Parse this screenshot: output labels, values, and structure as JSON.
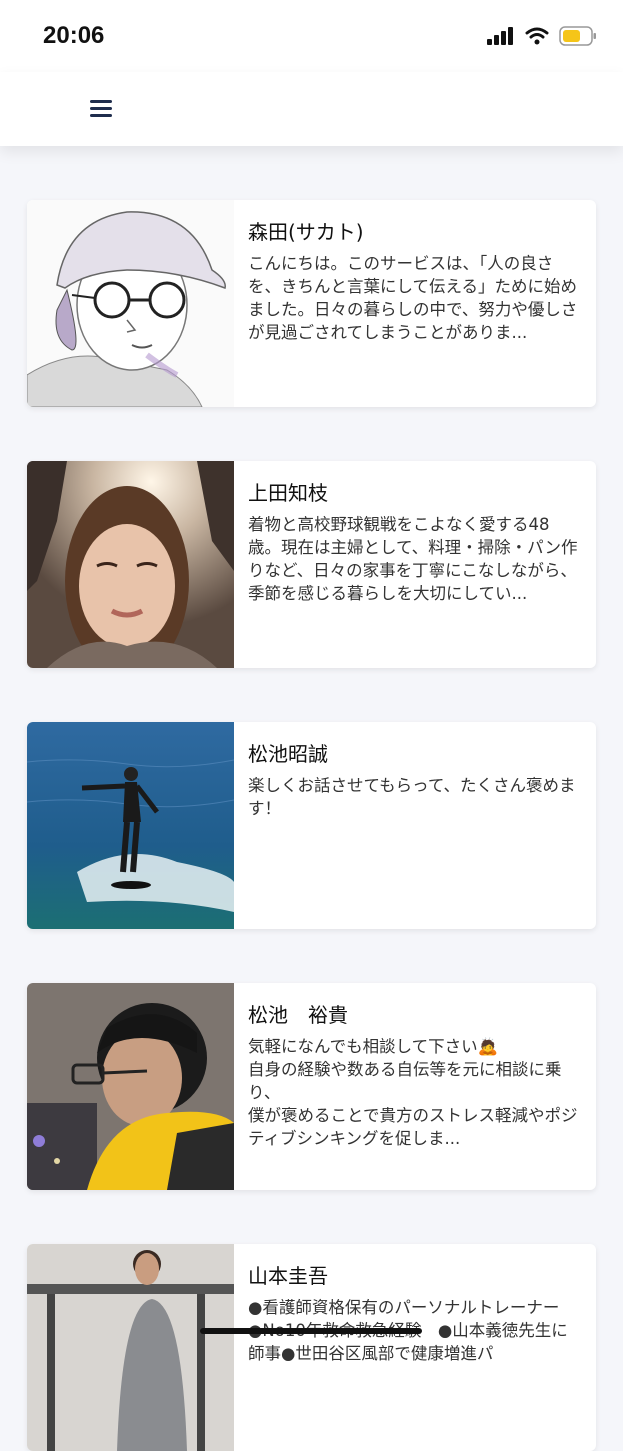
{
  "status_bar": {
    "time": "20:06",
    "icons": [
      "signal-icon",
      "wifi-icon",
      "battery-icon"
    ],
    "battery_color": "#f5c518"
  },
  "header": {
    "menu_icon": "hamburger-menu-icon",
    "accent": "#1f2d4d"
  },
  "profiles": [
    {
      "name": "森田(サカト)",
      "description": "こんにちは。このサービスは、「人の良さを、きちんと言葉にして伝える」ために始めました。日々の暮らしの中で、努力や優しさが見過ごされてしまうことがありま...",
      "photo": "sketch-portrait-with-cap"
    },
    {
      "name": "上田知枝",
      "description": "着物と高校野球観戦をこよなく愛する48歳。現在は主婦として、料理・掃除・パン作りなど、日々の家事を丁寧にこなしながら、季節を感じる暮らしを大切にしてい...",
      "photo": "woman-portrait"
    },
    {
      "name": "松池昭誠",
      "description": "楽しくお話させてもらって、たくさん褒めます！",
      "photo": "surfer-on-wave"
    },
    {
      "name": "松池　裕貴",
      "description": "気軽になんでも相談して下さい🙇\n自身の経験や数ある自伝等を元に相談に乗り、\n僕が褒めることで貴方のストレス軽減やポジティブシンキングを促しま...",
      "photo": "man-with-glasses-night-city"
    },
    {
      "name": "山本圭吾",
      "description": "●看護師資格保有のパーソナルトレーナー　●No10年救命救急経験　●山本義徳先生に師事●世田谷区風部で健康増進パ",
      "photo": "man-in-gym"
    }
  ]
}
